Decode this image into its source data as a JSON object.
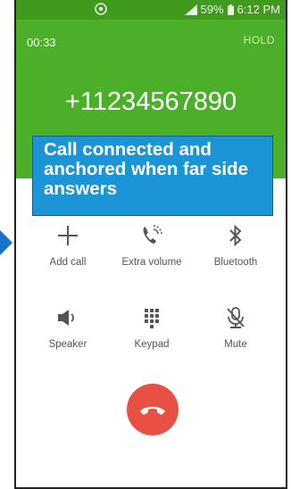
{
  "status_bar": {
    "battery": "59%",
    "time": "6:12 PM",
    "icons": [
      "chat-bubble-icon",
      "signal-icon",
      "battery-icon"
    ]
  },
  "call": {
    "timer": "00:33",
    "hold_label": "HOLD",
    "number": "+11234567890"
  },
  "annotation": {
    "text": "Call connected and anchored when far side answers"
  },
  "controls": [
    {
      "label": "Add call",
      "icon": "plus-icon"
    },
    {
      "label": "Extra volume",
      "icon": "extra-volume-icon"
    },
    {
      "label": "Bluetooth",
      "icon": "bluetooth-icon"
    },
    {
      "label": "Speaker",
      "icon": "speaker-icon"
    },
    {
      "label": "Keypad",
      "icon": "keypad-icon"
    },
    {
      "label": "Mute",
      "icon": "mute-icon"
    }
  ],
  "colors": {
    "header_green": "#4caf2a",
    "status_green": "#3f9a1d",
    "annotation_blue": "#1b95d6",
    "end_call_red": "#e94f43"
  }
}
